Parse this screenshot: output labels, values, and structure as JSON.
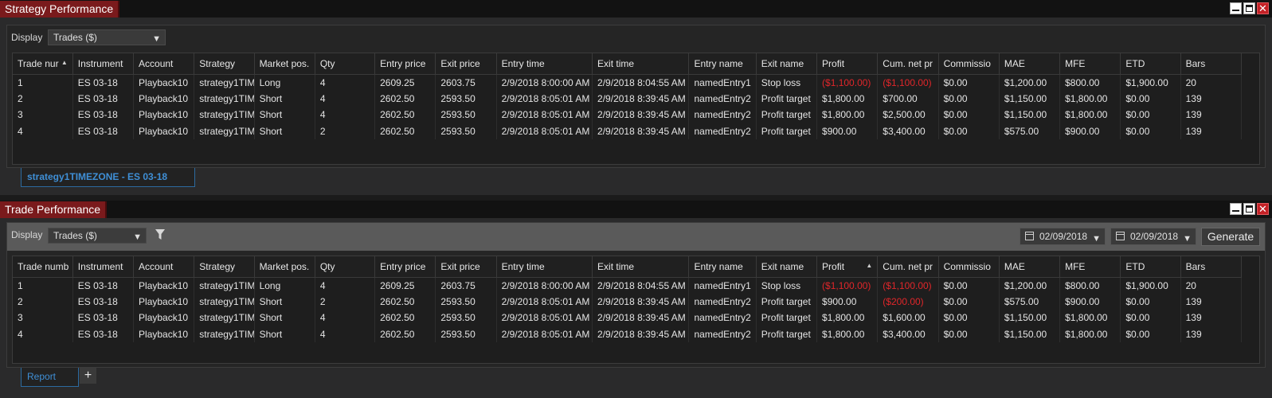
{
  "strategy_performance": {
    "title": "Strategy Performance",
    "display_label": "Display",
    "display_value": "Trades ($)",
    "tab_label": "strategy1TIMEZONE - ES 03-18",
    "columns": [
      "Trade nur",
      "Instrument",
      "Account",
      "Strategy",
      "Market pos.",
      "Qty",
      "Entry price",
      "Exit price",
      "Entry time",
      "Exit time",
      "Entry name",
      "Exit name",
      "Profit",
      "Cum. net pr",
      "Commissio",
      "MAE",
      "MFE",
      "ETD",
      "Bars"
    ],
    "rows": [
      [
        "1",
        "ES 03-18",
        "Playback10",
        "strategy1TIM",
        "Long",
        "4",
        "2609.25",
        "2603.75",
        "2/9/2018 8:00:00 AM",
        "2/9/2018 8:04:55 AM",
        "namedEntry1",
        "Stop loss",
        "($1,100.00)",
        "($1,100.00)",
        "$0.00",
        "$1,200.00",
        "$800.00",
        "$1,900.00",
        "20"
      ],
      [
        "2",
        "ES 03-18",
        "Playback10",
        "strategy1TIM",
        "Short",
        "4",
        "2602.50",
        "2593.50",
        "2/9/2018 8:05:01 AM",
        "2/9/2018 8:39:45 AM",
        "namedEntry2",
        "Profit target",
        "$1,800.00",
        "$700.00",
        "$0.00",
        "$1,150.00",
        "$1,800.00",
        "$0.00",
        "139"
      ],
      [
        "3",
        "ES 03-18",
        "Playback10",
        "strategy1TIM",
        "Short",
        "4",
        "2602.50",
        "2593.50",
        "2/9/2018 8:05:01 AM",
        "2/9/2018 8:39:45 AM",
        "namedEntry2",
        "Profit target",
        "$1,800.00",
        "$2,500.00",
        "$0.00",
        "$1,150.00",
        "$1,800.00",
        "$0.00",
        "139"
      ],
      [
        "4",
        "ES 03-18",
        "Playback10",
        "strategy1TIM",
        "Short",
        "2",
        "2602.50",
        "2593.50",
        "2/9/2018 8:05:01 AM",
        "2/9/2018 8:39:45 AM",
        "namedEntry2",
        "Profit target",
        "$900.00",
        "$3,400.00",
        "$0.00",
        "$575.00",
        "$900.00",
        "$0.00",
        "139"
      ]
    ]
  },
  "trade_performance": {
    "title": "Trade Performance",
    "display_label": "Display",
    "display_value": "Trades ($)",
    "date_from": "02/09/2018",
    "date_to": "02/09/2018",
    "generate_label": "Generate",
    "tab_label": "Report",
    "add_tab_label": "+",
    "columns": [
      "Trade numb",
      "Instrument",
      "Account",
      "Strategy",
      "Market pos.",
      "Qty",
      "Entry price",
      "Exit price",
      "Entry time",
      "Exit time",
      "Entry name",
      "Exit name",
      "Profit",
      "Cum. net pr",
      "Commissio",
      "MAE",
      "MFE",
      "ETD",
      "Bars"
    ],
    "rows": [
      [
        "1",
        "ES 03-18",
        "Playback10",
        "strategy1TIM",
        "Long",
        "4",
        "2609.25",
        "2603.75",
        "2/9/2018 8:00:00 AM",
        "2/9/2018 8:04:55 AM",
        "namedEntry1",
        "Stop loss",
        "($1,100.00)",
        "($1,100.00)",
        "$0.00",
        "$1,200.00",
        "$800.00",
        "$1,900.00",
        "20"
      ],
      [
        "2",
        "ES 03-18",
        "Playback10",
        "strategy1TIM",
        "Short",
        "2",
        "2602.50",
        "2593.50",
        "2/9/2018 8:05:01 AM",
        "2/9/2018 8:39:45 AM",
        "namedEntry2",
        "Profit target",
        "$900.00",
        "($200.00)",
        "$0.00",
        "$575.00",
        "$900.00",
        "$0.00",
        "139"
      ],
      [
        "3",
        "ES 03-18",
        "Playback10",
        "strategy1TIM",
        "Short",
        "4",
        "2602.50",
        "2593.50",
        "2/9/2018 8:05:01 AM",
        "2/9/2018 8:39:45 AM",
        "namedEntry2",
        "Profit target",
        "$1,800.00",
        "$1,600.00",
        "$0.00",
        "$1,150.00",
        "$1,800.00",
        "$0.00",
        "139"
      ],
      [
        "4",
        "ES 03-18",
        "Playback10",
        "strategy1TIM",
        "Short",
        "4",
        "2602.50",
        "2593.50",
        "2/9/2018 8:05:01 AM",
        "2/9/2018 8:39:45 AM",
        "namedEntry2",
        "Profit target",
        "$1,800.00",
        "$3,400.00",
        "$0.00",
        "$1,150.00",
        "$1,800.00",
        "$0.00",
        "139"
      ]
    ]
  },
  "colors": {
    "title_tab": "#7a1a1c",
    "negative": "#e0262a",
    "tab_accent": "#3f8fd6"
  }
}
